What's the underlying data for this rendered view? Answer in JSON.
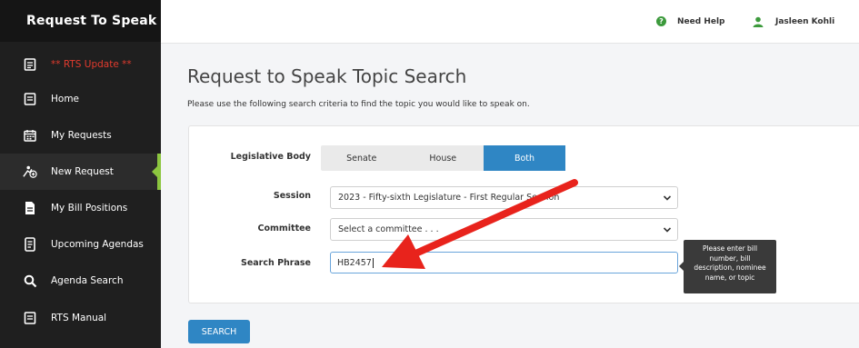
{
  "sidebar": {
    "title": "Request To Speak",
    "items": [
      {
        "label": "** RTS Update **",
        "icon": "document-icon",
        "alert": true
      },
      {
        "label": "Home",
        "icon": "document-icon"
      },
      {
        "label": "My Requests",
        "icon": "calendar-icon"
      },
      {
        "label": "New Request",
        "icon": "new-request-icon",
        "active": true
      },
      {
        "label": "My Bill Positions",
        "icon": "file-icon"
      },
      {
        "label": "Upcoming Agendas",
        "icon": "agenda-icon"
      },
      {
        "label": "Agenda Search",
        "icon": "search-icon"
      },
      {
        "label": "RTS Manual",
        "icon": "document-icon"
      }
    ]
  },
  "header": {
    "help_label": "Need Help",
    "user_name": "Jasleen Kohli"
  },
  "main": {
    "title": "Request to Speak Topic Search",
    "description": "Please use the following search criteria to find the topic you would like to speak on.",
    "form": {
      "legislative_body_label": "Legislative Body",
      "body_options": [
        "Senate",
        "House",
        "Both"
      ],
      "body_selected": "Both",
      "session_label": "Session",
      "session_value": "2023 - Fifty-sixth Legislature - First Regular Session",
      "committee_label": "Committee",
      "committee_value": "Select a committee . . .",
      "search_phrase_label": "Search Phrase",
      "search_phrase_value": "HB2457",
      "tooltip": "Please enter bill number, bill description, nominee name, or topic",
      "search_button": "SEARCH"
    }
  },
  "colors": {
    "accent": "#2f86c4",
    "sidebar_bg": "#1f1f1f",
    "active_marker": "#8cc63f",
    "alert_text": "#e23b2e",
    "annotation_arrow": "#e8231c"
  }
}
